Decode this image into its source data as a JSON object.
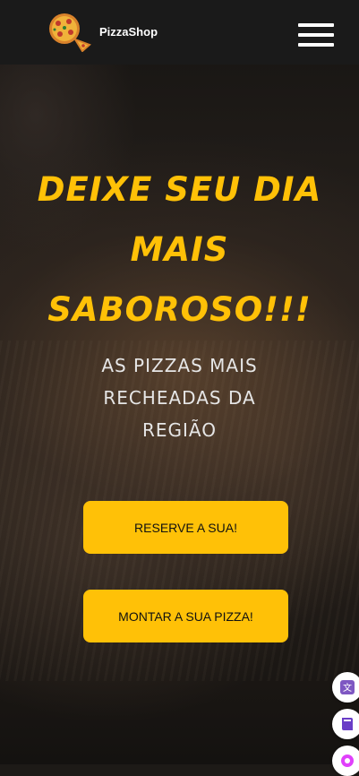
{
  "header": {
    "brand": "PizzaShop",
    "logo_icon": "pizza-logo-icon",
    "menu_icon": "hamburger-menu-icon"
  },
  "hero": {
    "title_lines": [
      "DEIXE SEU DIA",
      "MAIS",
      "SABOROSO!!!"
    ],
    "subtitle_lines": [
      "AS PIZZAS MAIS",
      "RECHEADAS DA",
      "REGIÃO"
    ]
  },
  "buttons": {
    "reserve": "RESERVE A SUA!",
    "build": "MONTAR A SUA PIZZA!"
  },
  "side_widgets": [
    "translate-icon",
    "book-icon",
    "assistant-icon"
  ],
  "colors": {
    "accent": "#ffc107",
    "header_bg": "#1a1a1a",
    "subtitle": "#e6e6e6"
  }
}
